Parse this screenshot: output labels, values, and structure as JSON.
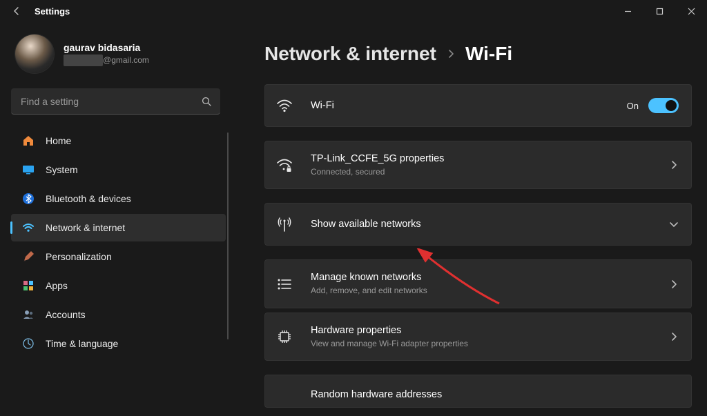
{
  "titlebar": {
    "title": "Settings"
  },
  "profile": {
    "name": "gaurav bidasaria",
    "email_suffix": "@gmail.com",
    "email_hidden_placeholder": "██████"
  },
  "search": {
    "placeholder": "Find a setting"
  },
  "nav": {
    "items": [
      {
        "label": "Home"
      },
      {
        "label": "System"
      },
      {
        "label": "Bluetooth & devices"
      },
      {
        "label": "Network & internet"
      },
      {
        "label": "Personalization"
      },
      {
        "label": "Apps"
      },
      {
        "label": "Accounts"
      },
      {
        "label": "Time & language"
      }
    ]
  },
  "breadcrumb": {
    "parent": "Network & internet",
    "current": "Wi-Fi"
  },
  "wifi_card": {
    "title": "Wi-Fi",
    "state": "On"
  },
  "cards": [
    {
      "title": "TP-Link_CCFE_5G properties",
      "sub": "Connected, secured",
      "right": "chevron-right"
    },
    {
      "title": "Show available networks",
      "sub": "",
      "right": "chevron-down"
    },
    {
      "title": "Manage known networks",
      "sub": "Add, remove, and edit networks",
      "right": "chevron-right"
    },
    {
      "title": "Hardware properties",
      "sub": "View and manage Wi-Fi adapter properties",
      "right": "chevron-right"
    },
    {
      "title": "Random hardware addresses",
      "sub": "",
      "right": ""
    }
  ]
}
